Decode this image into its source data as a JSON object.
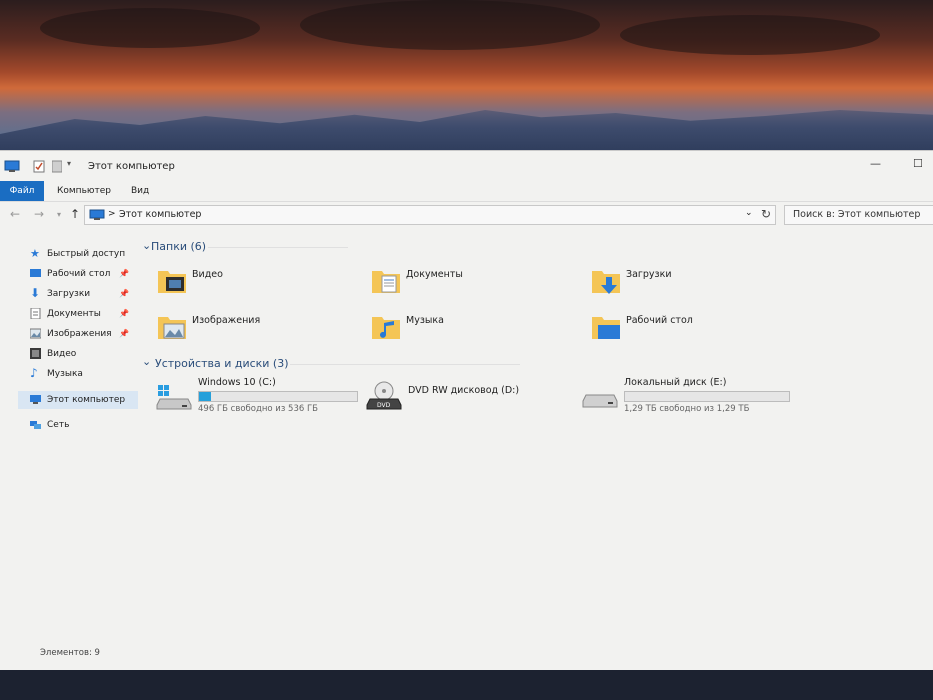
{
  "window": {
    "title": "Этот компьютер",
    "maximize_glyph": "☐",
    "minimize_glyph": "—"
  },
  "menu": {
    "file": "Файл",
    "computer": "Компьютер",
    "view": "Вид"
  },
  "address": {
    "location": "Этот компьютер",
    "separator": ">"
  },
  "search": {
    "placeholder": "Поиск в: Этот компьютер"
  },
  "sidebar": {
    "items": [
      {
        "label": "Быстрый доступ",
        "icon": "star-icon",
        "pinned": false
      },
      {
        "label": "Рабочий стол",
        "icon": "desktop-icon",
        "pinned": true
      },
      {
        "label": "Загрузки",
        "icon": "download-icon",
        "pinned": true
      },
      {
        "label": "Документы",
        "icon": "documents-icon",
        "pinned": true
      },
      {
        "label": "Изображения",
        "icon": "pictures-icon",
        "pinned": true
      },
      {
        "label": "Видео",
        "icon": "video-icon",
        "pinned": false
      },
      {
        "label": "Музыка",
        "icon": "music-icon",
        "pinned": false
      },
      {
        "label": "Этот компьютер",
        "icon": "computer-icon",
        "pinned": false
      },
      {
        "label": "Сеть",
        "icon": "network-icon",
        "pinned": false
      }
    ]
  },
  "folders_group": {
    "title": "Папки (6)",
    "items": [
      {
        "label": "Видео",
        "icon": "video-folder-icon"
      },
      {
        "label": "Документы",
        "icon": "documents-folder-icon"
      },
      {
        "label": "Загрузки",
        "icon": "downloads-folder-icon"
      },
      {
        "label": "Изображения",
        "icon": "pictures-folder-icon"
      },
      {
        "label": "Музыка",
        "icon": "music-folder-icon"
      },
      {
        "label": "Рабочий стол",
        "icon": "desktop-folder-icon"
      }
    ]
  },
  "drives_group": {
    "title": "Устройства и диски (3)",
    "items": [
      {
        "label": "Windows 10 (C:)",
        "icon": "windows-drive-icon",
        "free": "496 ГБ свободно из 536 ГБ",
        "used_fraction": 0.075
      },
      {
        "label": "DVD RW дисковод (D:)",
        "icon": "dvd-drive-icon",
        "free": "",
        "used_fraction": null
      },
      {
        "label": "Локальный диск (E:)",
        "icon": "local-drive-icon",
        "free": "1,29 ТБ свободно из 1,29 ТБ",
        "used_fraction": 0.0
      }
    ]
  },
  "status": {
    "items_count": "Элементов: 9"
  },
  "colors": {
    "accent": "#1a6dc2",
    "progress": "#26a0da",
    "folder": "#f4c556"
  }
}
